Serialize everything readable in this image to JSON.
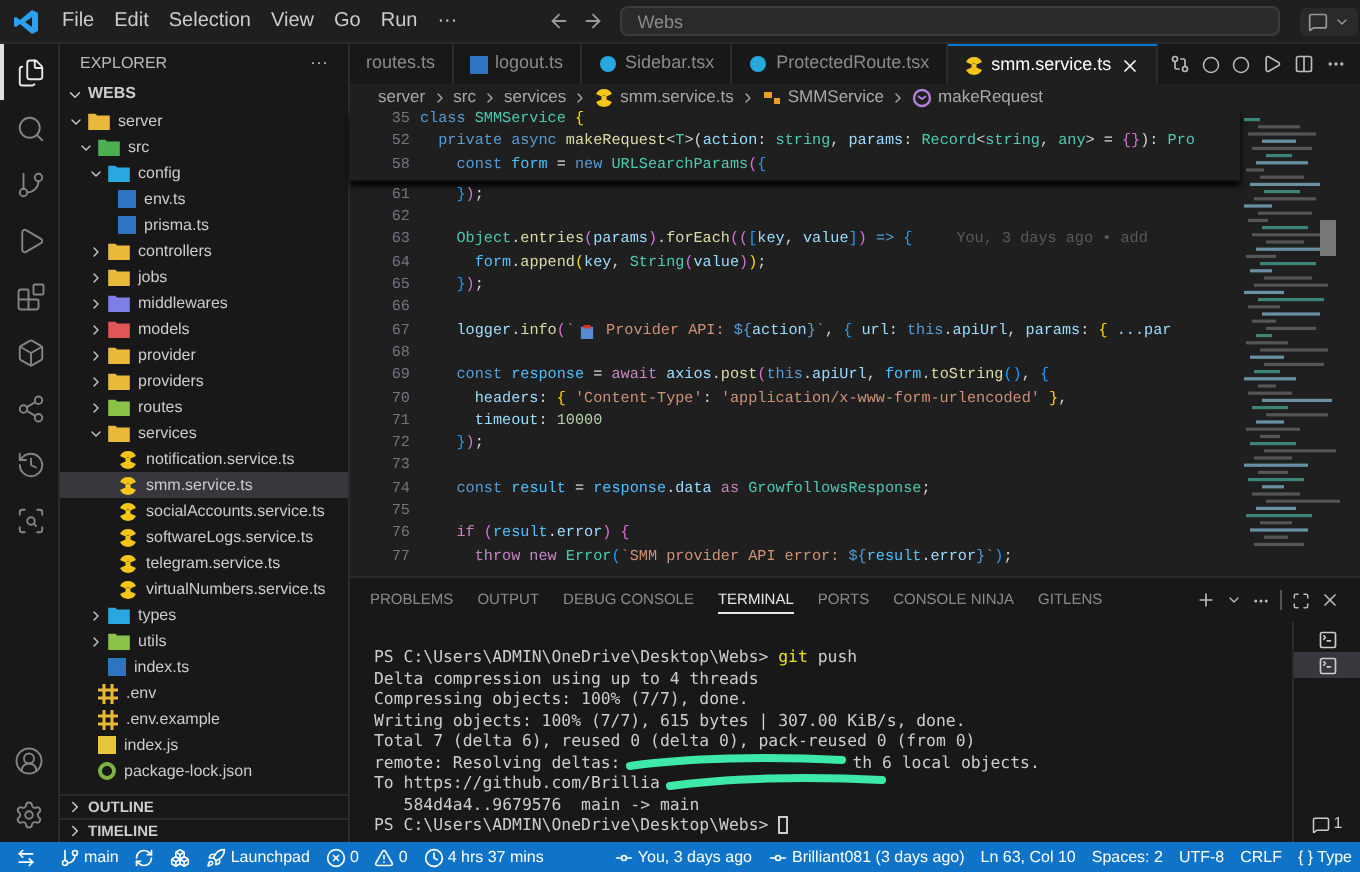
{
  "title_bar": {
    "menus": [
      "File",
      "Edit",
      "Selection",
      "View",
      "Go",
      "Run",
      "···"
    ],
    "search": {
      "value": "Webs"
    }
  },
  "activity_bar": [
    {
      "kind": "files",
      "selected": true
    },
    {
      "kind": "search",
      "selected": false
    },
    {
      "kind": "git",
      "selected": false
    },
    {
      "kind": "run",
      "selected": false
    },
    {
      "kind": "extensions",
      "selected": false
    },
    {
      "kind": "box",
      "selected": false
    },
    {
      "kind": "graph",
      "selected": false
    },
    {
      "kind": "history",
      "selected": false
    },
    {
      "kind": "inspect",
      "selected": false
    }
  ],
  "activity_bottom": [
    {
      "kind": "account"
    },
    {
      "kind": "settings"
    }
  ],
  "sidebar": {
    "title": "EXPLORER",
    "more": "···",
    "workspace": {
      "label": "WEBS",
      "expanded": true,
      "children": [
        {
          "label": "server",
          "kind": "folder",
          "color": "#e8b93a",
          "expanded": true,
          "selected": false,
          "children": [
            {
              "label": "src",
              "kind": "folder",
              "color": "#4caf50",
              "expanded": true,
              "selected": false,
              "children": [
                {
                  "label": "config",
                  "kind": "folder",
                  "color": "#29a8e0",
                  "expanded": true,
                  "selected": false,
                  "children": [
                    {
                      "label": "env.ts",
                      "kind": "ts",
                      "selected": false
                    },
                    {
                      "label": "prisma.ts",
                      "kind": "ts",
                      "selected": false
                    }
                  ]
                },
                {
                  "label": "controllers",
                  "kind": "folder",
                  "color": "#e8b93a",
                  "expanded": false,
                  "selected": false
                },
                {
                  "label": "jobs",
                  "kind": "folder",
                  "color": "#e8b93a",
                  "expanded": false,
                  "selected": false
                },
                {
                  "label": "middlewares",
                  "kind": "folder",
                  "color": "#7e7ee6",
                  "expanded": false,
                  "selected": false
                },
                {
                  "label": "models",
                  "kind": "folder",
                  "color": "#e05555",
                  "expanded": false,
                  "selected": false
                },
                {
                  "label": "provider",
                  "kind": "folder",
                  "color": "#e8b93a",
                  "expanded": false,
                  "selected": false
                },
                {
                  "label": "providers",
                  "kind": "folder",
                  "color": "#e8b93a",
                  "expanded": false,
                  "selected": false
                },
                {
                  "label": "routes",
                  "kind": "folder",
                  "color": "#8bc34a",
                  "expanded": false,
                  "selected": false
                },
                {
                  "label": "services",
                  "kind": "folder",
                  "color": "#e8b93a",
                  "expanded": true,
                  "selected": false,
                  "children": [
                    {
                      "label": "notification.service.ts",
                      "kind": "service",
                      "selected": false
                    },
                    {
                      "label": "smm.service.ts",
                      "kind": "service",
                      "selected": true
                    },
                    {
                      "label": "socialAccounts.service.ts",
                      "kind": "service",
                      "selected": false
                    },
                    {
                      "label": "softwareLogs.service.ts",
                      "kind": "service",
                      "selected": false
                    },
                    {
                      "label": "telegram.service.ts",
                      "kind": "service",
                      "selected": false
                    },
                    {
                      "label": "virtualNumbers.service.ts",
                      "kind": "service",
                      "selected": false
                    }
                  ]
                },
                {
                  "label": "types",
                  "kind": "folder",
                  "color": "#29a8e0",
                  "expanded": false,
                  "selected": false
                },
                {
                  "label": "utils",
                  "kind": "folder",
                  "color": "#8bc34a",
                  "expanded": false,
                  "selected": false
                },
                {
                  "label": "index.ts",
                  "kind": "ts",
                  "selected": false
                }
              ]
            },
            {
              "label": ".env",
              "kind": "env",
              "selected": false
            },
            {
              "label": ".env.example",
              "kind": "env",
              "selected": false
            },
            {
              "label": "index.js",
              "kind": "js",
              "selected": false
            },
            {
              "label": "package-lock.json",
              "kind": "json",
              "selected": false
            }
          ]
        }
      ]
    },
    "sections": [
      {
        "label": "OUTLINE",
        "expanded": false
      },
      {
        "label": "TIMELINE",
        "expanded": false
      }
    ]
  },
  "tabs": [
    {
      "label": "routes.ts",
      "kind": "none",
      "selected": false
    },
    {
      "label": "logout.ts",
      "kind": "ts",
      "selected": false
    },
    {
      "label": "Sidebar.tsx",
      "kind": "react",
      "selected": false
    },
    {
      "label": "ProtectedRoute.tsx",
      "kind": "react",
      "selected": false
    },
    {
      "label": "smm.service.ts",
      "kind": "service",
      "selected": true
    }
  ],
  "breadcrumb": [
    {
      "label": "server",
      "kind": "text"
    },
    {
      "label": "src",
      "kind": "text"
    },
    {
      "label": "services",
      "kind": "text"
    },
    {
      "label": "smm.service.ts",
      "kind": "service"
    },
    {
      "label": "SMMService",
      "kind": "class"
    },
    {
      "label": "makeRequest",
      "kind": "method"
    }
  ],
  "sticky_lines": [
    {
      "num": "35",
      "tokens": [
        {
          "text": "class ",
          "kind": "kw"
        },
        {
          "text": "SMMService ",
          "kind": "cls"
        },
        {
          "text": "{",
          "kind": "br"
        }
      ]
    },
    {
      "num": "52",
      "tokens": [
        {
          "text": "  private async ",
          "kind": "kw"
        },
        {
          "text": "makeRequest",
          "kind": "fn"
        },
        {
          "text": "<",
          "kind": "p"
        },
        {
          "text": "T",
          "kind": "cls"
        },
        {
          "text": ">(",
          "kind": "p"
        },
        {
          "text": "action",
          "kind": "var"
        },
        {
          "text": ": ",
          "kind": "p"
        },
        {
          "text": "string",
          "kind": "cls"
        },
        {
          "text": ", ",
          "kind": "p"
        },
        {
          "text": "params",
          "kind": "var"
        },
        {
          "text": ": ",
          "kind": "p"
        },
        {
          "text": "Record",
          "kind": "cls"
        },
        {
          "text": "<",
          "kind": "p"
        },
        {
          "text": "string",
          "kind": "cls"
        },
        {
          "text": ", ",
          "kind": "p"
        },
        {
          "text": "any",
          "kind": "cls"
        },
        {
          "text": "> = ",
          "kind": "p"
        },
        {
          "text": "{}",
          "kind": "br2"
        },
        {
          "text": "): ",
          "kind": "p"
        },
        {
          "text": "Pro",
          "kind": "cls"
        }
      ]
    },
    {
      "num": "58",
      "tokens": [
        {
          "text": "    const ",
          "kind": "kw"
        },
        {
          "text": "form",
          "kind": "const"
        },
        {
          "text": " = ",
          "kind": "p"
        },
        {
          "text": "new ",
          "kind": "kw"
        },
        {
          "text": "URLSearchParams",
          "kind": "cls"
        },
        {
          "text": "(",
          "kind": "br2"
        },
        {
          "text": "{",
          "kind": "br3"
        }
      ]
    }
  ],
  "lines": [
    {
      "num": "61",
      "tokens": [
        {
          "text": "    }",
          "kind": "br3"
        },
        {
          "text": ")",
          "kind": "br2"
        },
        {
          "text": ";",
          "kind": "p"
        }
      ]
    },
    {
      "num": "62"
    },
    {
      "num": "63",
      "tokens": [
        {
          "text": "    Object",
          "kind": "cls"
        },
        {
          "text": ".",
          "kind": "p"
        },
        {
          "text": "entries",
          "kind": "fn"
        },
        {
          "text": "(",
          "kind": "br2"
        },
        {
          "text": "params",
          "kind": "var"
        },
        {
          "text": ")",
          "kind": "br2"
        },
        {
          "text": ".",
          "kind": "p"
        },
        {
          "text": "forEach",
          "kind": "fn"
        },
        {
          "text": "((",
          "kind": "br2"
        },
        {
          "text": "[",
          "kind": "br3"
        },
        {
          "text": "key",
          "kind": "var"
        },
        {
          "text": ", ",
          "kind": "p"
        },
        {
          "text": "value",
          "kind": "var"
        },
        {
          "text": "]",
          "kind": "br3"
        },
        {
          "text": ") ",
          "kind": "br2"
        },
        {
          "text": "=> ",
          "kind": "kw"
        },
        {
          "text": "{",
          "kind": "br3"
        }
      ],
      "blame": "You, 3 days ago • add"
    },
    {
      "num": "64",
      "tokens": [
        {
          "text": "      form",
          "kind": "const"
        },
        {
          "text": ".",
          "kind": "p"
        },
        {
          "text": "append",
          "kind": "fn"
        },
        {
          "text": "(",
          "kind": "br"
        },
        {
          "text": "key",
          "kind": "var"
        },
        {
          "text": ", ",
          "kind": "p"
        },
        {
          "text": "String",
          "kind": "cls"
        },
        {
          "text": "(",
          "kind": "br2"
        },
        {
          "text": "value",
          "kind": "var"
        },
        {
          "text": ")",
          "kind": "br2"
        },
        {
          "text": ")",
          "kind": "br"
        },
        {
          "text": ";",
          "kind": "p"
        }
      ]
    },
    {
      "num": "65",
      "tokens": [
        {
          "text": "    }",
          "kind": "br3"
        },
        {
          "text": ")",
          "kind": "br2"
        },
        {
          "text": ";",
          "kind": "p"
        }
      ]
    },
    {
      "num": "66"
    },
    {
      "num": "67",
      "tokens": [
        {
          "text": "    logger",
          "kind": "var"
        },
        {
          "text": ".",
          "kind": "p"
        },
        {
          "text": "info",
          "kind": "fn"
        },
        {
          "text": "(",
          "kind": "br2"
        },
        {
          "text": "`",
          "kind": "str"
        },
        {
          "kind": "icon"
        },
        {
          "text": " Provider API: ",
          "kind": "str"
        },
        {
          "text": "${",
          "kind": "kw"
        },
        {
          "text": "action",
          "kind": "var"
        },
        {
          "text": "}",
          "kind": "kw"
        },
        {
          "text": "`",
          "kind": "str"
        },
        {
          "text": ", ",
          "kind": "p"
        },
        {
          "text": "{ ",
          "kind": "br3"
        },
        {
          "text": "url",
          "kind": "var"
        },
        {
          "text": ": ",
          "kind": "p"
        },
        {
          "text": "this",
          "kind": "kw"
        },
        {
          "text": ".",
          "kind": "p"
        },
        {
          "text": "apiUrl",
          "kind": "var"
        },
        {
          "text": ", ",
          "kind": "p"
        },
        {
          "text": "params",
          "kind": "var"
        },
        {
          "text": ": ",
          "kind": "p"
        },
        {
          "text": "{ ",
          "kind": "br"
        },
        {
          "text": "...par",
          "kind": "var"
        }
      ]
    },
    {
      "num": "68"
    },
    {
      "num": "69",
      "tokens": [
        {
          "text": "    const ",
          "kind": "kw"
        },
        {
          "text": "response",
          "kind": "const"
        },
        {
          "text": " = ",
          "kind": "p"
        },
        {
          "text": "await ",
          "kind": "ctrl"
        },
        {
          "text": "axios",
          "kind": "var"
        },
        {
          "text": ".",
          "kind": "p"
        },
        {
          "text": "post",
          "kind": "fn"
        },
        {
          "text": "(",
          "kind": "br2"
        },
        {
          "text": "this",
          "kind": "kw"
        },
        {
          "text": ".",
          "kind": "p"
        },
        {
          "text": "apiUrl",
          "kind": "var"
        },
        {
          "text": ", ",
          "kind": "p"
        },
        {
          "text": "form",
          "kind": "const"
        },
        {
          "text": ".",
          "kind": "p"
        },
        {
          "text": "toString",
          "kind": "fn"
        },
        {
          "text": "()",
          "kind": "br3"
        },
        {
          "text": ", ",
          "kind": "p"
        },
        {
          "text": "{",
          "kind": "br3"
        }
      ]
    },
    {
      "num": "70",
      "tokens": [
        {
          "text": "      headers",
          "kind": "var"
        },
        {
          "text": ": ",
          "kind": "p"
        },
        {
          "text": "{ ",
          "kind": "br"
        },
        {
          "text": "'Content-Type'",
          "kind": "str"
        },
        {
          "text": ": ",
          "kind": "p"
        },
        {
          "text": "'application/x-www-form-urlencoded'",
          "kind": "str"
        },
        {
          "text": " }",
          "kind": "br"
        },
        {
          "text": ",",
          "kind": "p"
        }
      ]
    },
    {
      "num": "71",
      "tokens": [
        {
          "text": "      timeout",
          "kind": "var"
        },
        {
          "text": ": ",
          "kind": "p"
        },
        {
          "text": "10000",
          "kind": "num"
        }
      ]
    },
    {
      "num": "72",
      "tokens": [
        {
          "text": "    }",
          "kind": "br3"
        },
        {
          "text": ")",
          "kind": "br2"
        },
        {
          "text": ";",
          "kind": "p"
        }
      ]
    },
    {
      "num": "73"
    },
    {
      "num": "74",
      "tokens": [
        {
          "text": "    const ",
          "kind": "kw"
        },
        {
          "text": "result",
          "kind": "const"
        },
        {
          "text": " = ",
          "kind": "p"
        },
        {
          "text": "response",
          "kind": "const"
        },
        {
          "text": ".",
          "kind": "p"
        },
        {
          "text": "data",
          "kind": "var"
        },
        {
          "text": " as ",
          "kind": "ctrl"
        },
        {
          "text": "GrowfollowsResponse",
          "kind": "cls"
        },
        {
          "text": ";",
          "kind": "p"
        }
      ]
    },
    {
      "num": "75"
    },
    {
      "num": "76",
      "tokens": [
        {
          "text": "    if ",
          "kind": "ctrl"
        },
        {
          "text": "(",
          "kind": "br2"
        },
        {
          "text": "result",
          "kind": "const"
        },
        {
          "text": ".",
          "kind": "p"
        },
        {
          "text": "error",
          "kind": "var"
        },
        {
          "text": ") ",
          "kind": "br2"
        },
        {
          "text": "{",
          "kind": "br2"
        }
      ]
    },
    {
      "num": "77",
      "tokens": [
        {
          "text": "      throw new ",
          "kind": "ctrl"
        },
        {
          "text": "Error",
          "kind": "cls"
        },
        {
          "text": "(",
          "kind": "br3"
        },
        {
          "text": "`SMM provider API error: ",
          "kind": "str"
        },
        {
          "text": "${",
          "kind": "kw"
        },
        {
          "text": "result",
          "kind": "const"
        },
        {
          "text": ".",
          "kind": "p"
        },
        {
          "text": "error",
          "kind": "var"
        },
        {
          "text": "}",
          "kind": "kw"
        },
        {
          "text": "`",
          "kind": "str"
        },
        {
          "text": ")",
          "kind": "br3"
        },
        {
          "text": ";",
          "kind": "p"
        }
      ]
    }
  ],
  "panel": {
    "tabs": [
      {
        "label": "PROBLEMS",
        "selected": false
      },
      {
        "label": "OUTPUT",
        "selected": false
      },
      {
        "label": "DEBUG CONSOLE",
        "selected": false
      },
      {
        "label": "TERMINAL",
        "selected": true
      },
      {
        "label": "PORTS",
        "selected": false
      },
      {
        "label": "CONSOLE NINJA",
        "selected": false
      },
      {
        "label": "GITLENS",
        "selected": false
      }
    ],
    "terminals": [
      {
        "selected": false
      },
      {
        "selected": true
      }
    ],
    "terminal_count": "1",
    "terminal_lines": [
      [
        {
          "text": "PS C:\\Users\\ADMIN\\OneDrive\\Desktop\\Webs> ",
          "kind": "text"
        },
        {
          "text": "git",
          "kind": "cmd"
        },
        {
          "text": " push",
          "kind": "text"
        }
      ],
      [
        {
          "text": "Delta compression using up to 4 threads",
          "kind": "text"
        }
      ],
      [
        {
          "text": "Compressing objects: 100% (7/7), done.",
          "kind": "text"
        }
      ],
      [
        {
          "text": "Writing objects: 100% (7/7), 615 bytes | 307.00 KiB/s, done.",
          "kind": "text"
        }
      ],
      [
        {
          "text": "Total 7 (delta 6), reused 0 (delta 0), pack-reused 0 (from 0)",
          "kind": "text"
        }
      ],
      [
        {
          "text": "remote: Resolving deltas:",
          "kind": "text"
        },
        {
          "kind": "redacted"
        },
        {
          "text": "th 6 local objects.",
          "kind": "text"
        }
      ],
      [
        {
          "text": "To https://github.com/Brillia",
          "kind": "text"
        },
        {
          "kind": "redacted"
        }
      ],
      [
        {
          "text": "   584d4a4..9679576  main -> main",
          "kind": "text"
        }
      ],
      [
        {
          "text": "PS C:\\Users\\ADMIN\\OneDrive\\Desktop\\Webs> ",
          "kind": "text"
        },
        {
          "kind": "cursor"
        }
      ]
    ]
  },
  "status_bar": {
    "left": [
      {
        "kind": "remote"
      },
      {
        "kind": "branch",
        "text": "main"
      },
      {
        "kind": "sync"
      },
      {
        "kind": "graph"
      },
      {
        "kind": "launchpad",
        "text": "Launchpad"
      },
      {
        "kind": "errors",
        "text": "0"
      },
      {
        "kind": "warnings",
        "text": "0"
      },
      {
        "kind": "clock",
        "text": "4 hrs 37 mins"
      }
    ],
    "right": [
      {
        "kind": "commit",
        "text": "You, 3 days ago"
      },
      {
        "kind": "commit",
        "text": "Brilliant081 (3 days ago)"
      },
      {
        "kind": "text",
        "text": "Ln 63, Col 10"
      },
      {
        "kind": "text",
        "text": "Spaces: 2"
      },
      {
        "kind": "text",
        "text": "UTF-8"
      },
      {
        "kind": "text",
        "text": "CRLF"
      },
      {
        "kind": "text",
        "text": "{ } Type"
      }
    ]
  }
}
